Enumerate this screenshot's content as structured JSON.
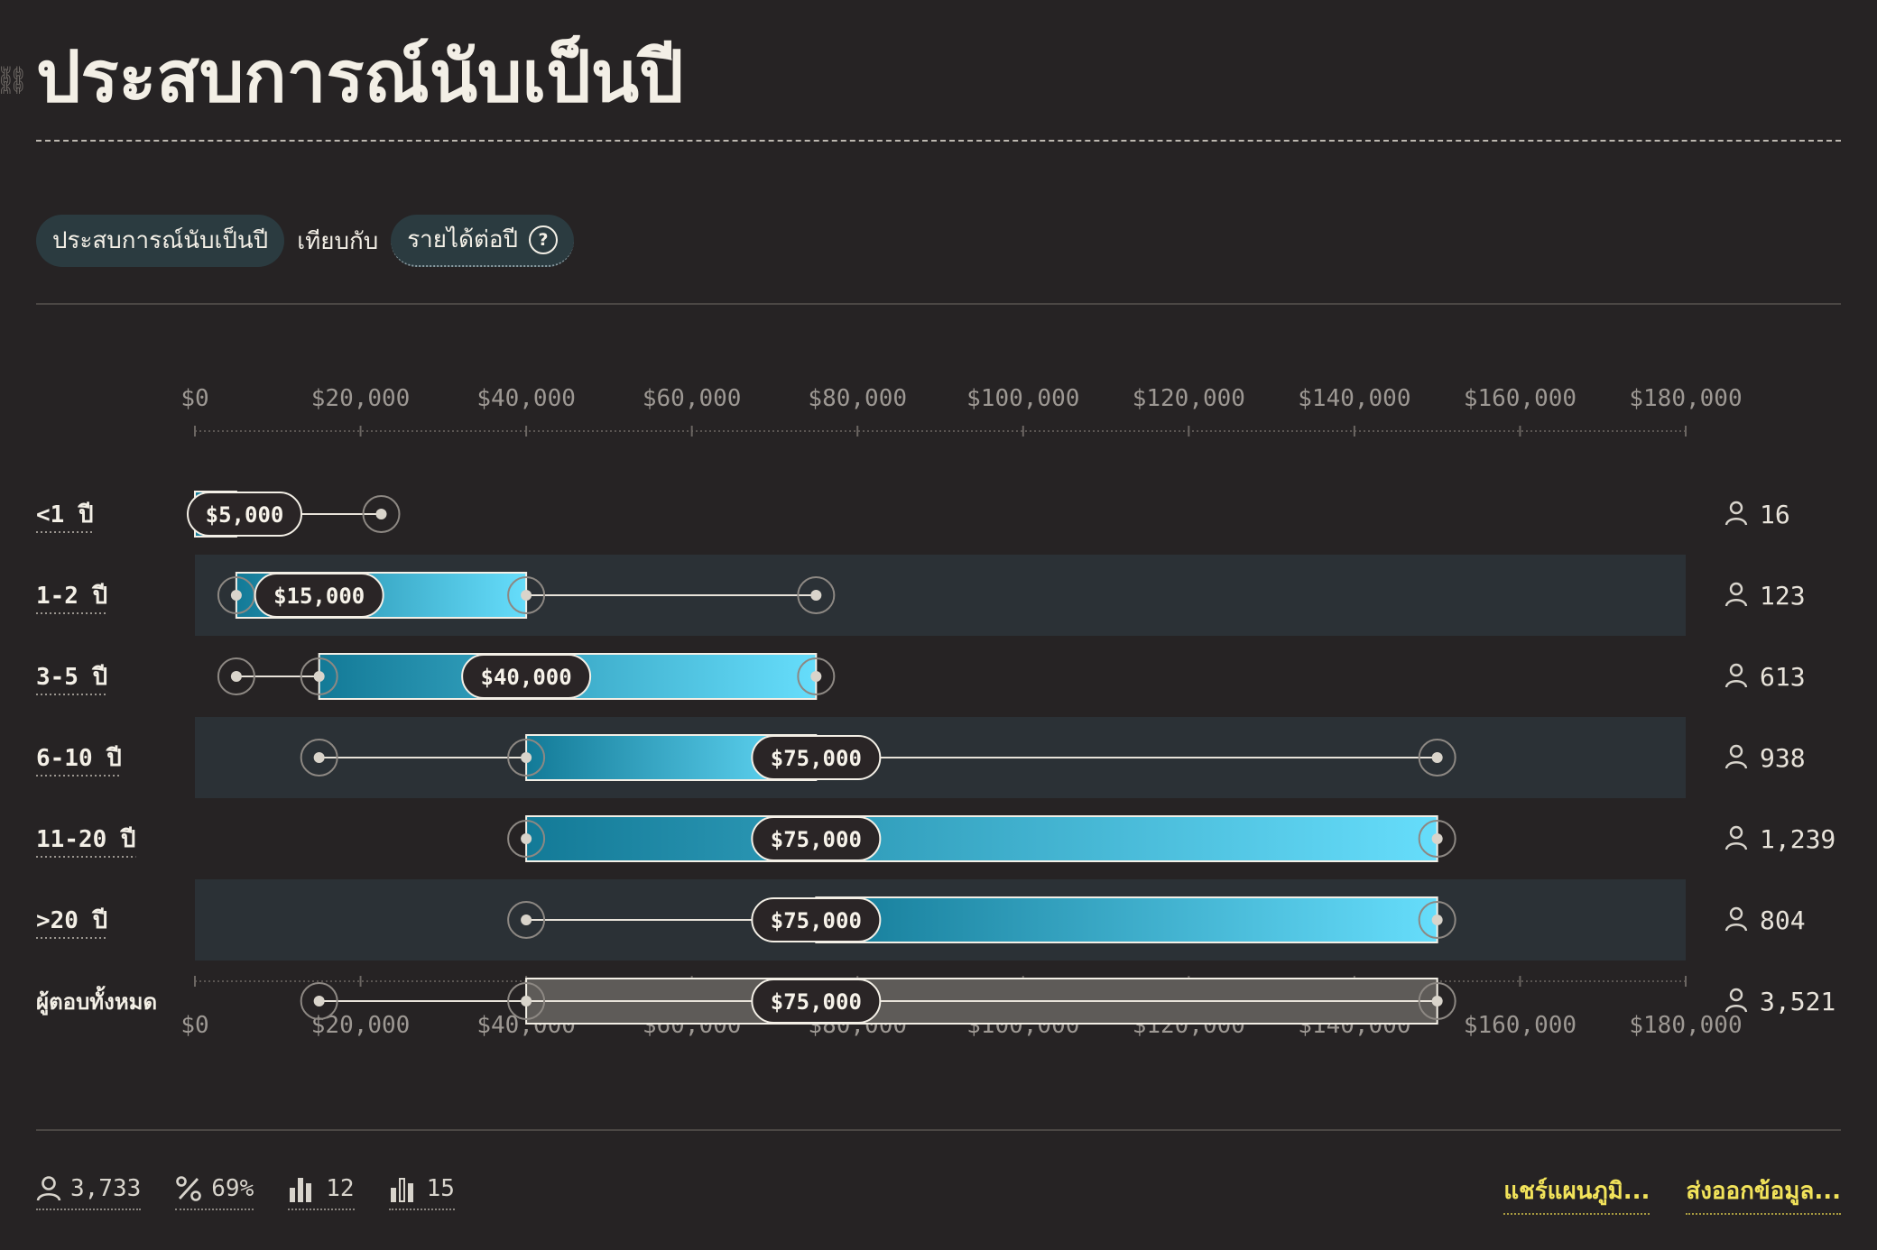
{
  "header": {
    "title": "ประสบการณ์นับเป็นปี"
  },
  "controls": {
    "group_by_label": "ประสบการณ์นับเป็นปี",
    "versus_label": "เทียบกับ",
    "metric_label": "รายได้ต่อปี",
    "help_glyph": "?"
  },
  "icons": {
    "respondents": "person-icon",
    "percent": "percent-icon",
    "bars": "bar-chart-icon",
    "bars_alt": "bar-chart-outline-icon",
    "link": "link-icon",
    "help": "help-icon"
  },
  "colors": {
    "background": "#262324",
    "band": "#2b3136",
    "bar_start": "#137a97",
    "bar_end": "#66ddfb",
    "total_bar": "#5e5b58",
    "accent_link": "#f2e35a"
  },
  "chart_data": {
    "type": "box",
    "xlim": [
      0,
      180000
    ],
    "ticks": [
      "$0",
      "$20,000",
      "$40,000",
      "$60,000",
      "$80,000",
      "$100,000",
      "$120,000",
      "$140,000",
      "$160,000",
      "$180,000"
    ],
    "tick_values": [
      0,
      20000,
      40000,
      60000,
      80000,
      100000,
      120000,
      140000,
      160000,
      180000
    ],
    "rows": [
      {
        "label": "<1 ปี",
        "min": 0,
        "q1": 0,
        "median": 5000,
        "q3": 5000,
        "max": 22500,
        "median_label": "$5,000",
        "count": "16",
        "banded": false,
        "dotted_label": true
      },
      {
        "label": "1-2 ปี",
        "min": 5000,
        "q1": 5000,
        "median": 15000,
        "q3": 40000,
        "max": 75000,
        "median_label": "$15,000",
        "count": "123",
        "banded": true,
        "dotted_label": true
      },
      {
        "label": "3-5 ปี",
        "min": 5000,
        "q1": 15000,
        "median": 40000,
        "q3": 75000,
        "max": 75000,
        "median_label": "$40,000",
        "count": "613",
        "banded": false,
        "dotted_label": true
      },
      {
        "label": "6-10 ปี",
        "min": 15000,
        "q1": 40000,
        "median": 75000,
        "q3": 75000,
        "max": 150000,
        "median_label": "$75,000",
        "count": "938",
        "banded": true,
        "dotted_label": true
      },
      {
        "label": "11-20 ปี",
        "min": 40000,
        "q1": 40000,
        "median": 75000,
        "q3": 150000,
        "max": 150000,
        "median_label": "$75,000",
        "count": "1,239",
        "banded": false,
        "dotted_label": true
      },
      {
        "label": ">20 ปี",
        "min": 40000,
        "q1": 75000,
        "median": 75000,
        "q3": 150000,
        "max": 150000,
        "median_label": "$75,000",
        "count": "804",
        "banded": true,
        "dotted_label": true
      },
      {
        "label": "ผู้ตอบทั้งหมด",
        "min": 15000,
        "q1": 40000,
        "median": 75000,
        "q3": 150000,
        "max": 150000,
        "median_label": "$75,000",
        "count": "3,521",
        "banded": false,
        "dotted_label": false,
        "total": true
      }
    ]
  },
  "footer": {
    "respondents": "3,733",
    "percent": "69%",
    "bars_a": "12",
    "bars_b": "15",
    "share_label": "แชร์แผนภูมิ...",
    "export_label": "ส่งออกข้อมูล..."
  }
}
